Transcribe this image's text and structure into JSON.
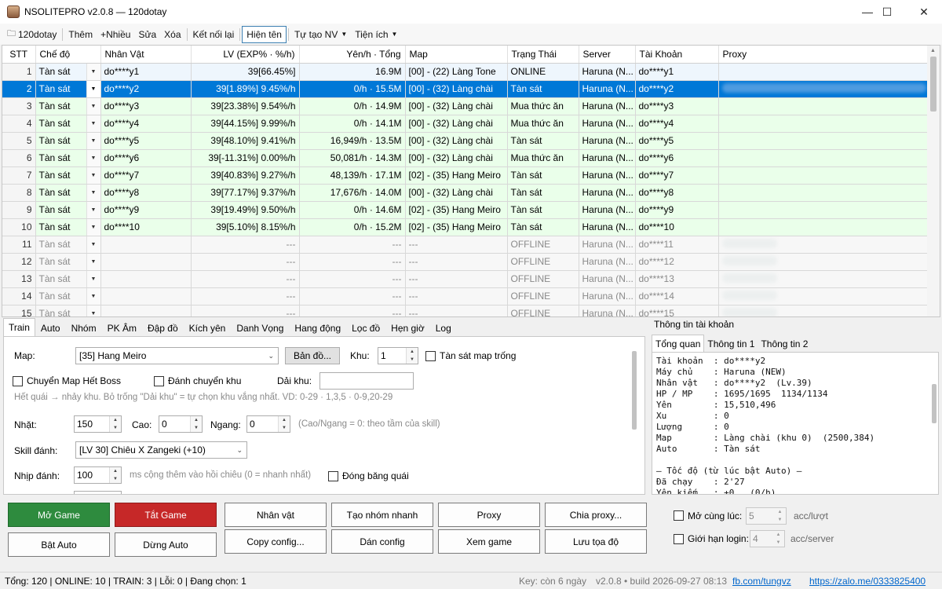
{
  "window": {
    "title": "NSOLITEPRO v2.0.8 — 120dotay",
    "minimize": "—",
    "maximize": "☐",
    "close": "✕"
  },
  "menu": [
    {
      "label": "120dotay",
      "icon": "folder-icon"
    },
    {
      "label": "Thêm"
    },
    {
      "label": "+Nhiều"
    },
    {
      "label": "Sửa"
    },
    {
      "label": "Xóa"
    },
    {
      "label": "Kết nối lại"
    },
    {
      "label": "Hiện tên",
      "selected": true
    },
    {
      "label": "Tự tạo NV",
      "dropdown": true
    },
    {
      "label": "Tiện ích",
      "dropdown": true
    }
  ],
  "grid": {
    "columns": [
      "STT",
      "Chế độ",
      "Nhân Vật",
      "LV (EXP% · %/h)",
      "Yên/h · Tổng",
      "Map",
      "Trạng Thái",
      "Server",
      "Tài Khoản",
      "Proxy"
    ],
    "rows": [
      {
        "stt": "1",
        "mode": "Tàn sát",
        "name": "do****y1",
        "lv": "39[66.45%]",
        "yen": "16.9M",
        "map": "[00] - (22) Làng Tone",
        "state": "ONLINE",
        "server": "Haruna (N...",
        "acct": "do****y1",
        "style": "first"
      },
      {
        "stt": "2",
        "mode": "Tàn sát",
        "name": "do****y2",
        "lv": "39[1.89%]  9.45%/h",
        "yen": "0/h  ·  15.5M",
        "map": "[00] - (32) Làng chài",
        "state": "Tàn sát",
        "server": "Haruna (N...",
        "acct": "do****y2",
        "style": "sel"
      },
      {
        "stt": "3",
        "mode": "Tàn sát",
        "name": "do****y3",
        "lv": "39[23.38%]  9.54%/h",
        "yen": "0/h  ·  14.9M",
        "map": "[00] - (32) Làng chài",
        "state": "Mua thức ăn",
        "server": "Haruna (N...",
        "acct": "do****y3",
        "style": "on"
      },
      {
        "stt": "4",
        "mode": "Tàn sát",
        "name": "do****y4",
        "lv": "39[44.15%]  9.99%/h",
        "yen": "0/h  ·  14.1M",
        "map": "[00] - (32) Làng chài",
        "state": "Mua thức ăn",
        "server": "Haruna (N...",
        "acct": "do****y4",
        "style": "on"
      },
      {
        "stt": "5",
        "mode": "Tàn sát",
        "name": "do****y5",
        "lv": "39[48.10%]  9.41%/h",
        "yen": "16,949/h  ·  13.5M",
        "map": "[00] - (32) Làng chài",
        "state": "Tàn sát",
        "server": "Haruna (N...",
        "acct": "do****y5",
        "style": "on"
      },
      {
        "stt": "6",
        "mode": "Tàn sát",
        "name": "do****y6",
        "lv": "39[-11.31%]  0.00%/h",
        "yen": "50,081/h  ·  14.3M",
        "map": "[00] - (32) Làng chài",
        "state": "Mua thức ăn",
        "server": "Haruna (N...",
        "acct": "do****y6",
        "style": "on"
      },
      {
        "stt": "7",
        "mode": "Tàn sát",
        "name": "do****y7",
        "lv": "39[40.83%]  9.27%/h",
        "yen": "48,139/h  ·  17.1M",
        "map": "[02] - (35) Hang Meiro",
        "state": "Tàn sát",
        "server": "Haruna (N...",
        "acct": "do****y7",
        "style": "on"
      },
      {
        "stt": "8",
        "mode": "Tàn sát",
        "name": "do****y8",
        "lv": "39[77.17%]  9.37%/h",
        "yen": "17,676/h  ·  14.0M",
        "map": "[00] - (32) Làng chài",
        "state": "Tàn sát",
        "server": "Haruna (N...",
        "acct": "do****y8",
        "style": "on"
      },
      {
        "stt": "9",
        "mode": "Tàn sát",
        "name": "do****y9",
        "lv": "39[19.49%]  9.50%/h",
        "yen": "0/h  ·  14.6M",
        "map": "[02] - (35) Hang Meiro",
        "state": "Tàn sát",
        "server": "Haruna (N...",
        "acct": "do****y9",
        "style": "on"
      },
      {
        "stt": "10",
        "mode": "Tàn sát",
        "name": "do****10",
        "lv": "39[5.10%]  8.15%/h",
        "yen": "0/h  ·  15.2M",
        "map": "[02] - (35) Hang Meiro",
        "state": "Tàn sát",
        "server": "Haruna (N...",
        "acct": "do****10",
        "style": "on"
      },
      {
        "stt": "11",
        "mode": "Tàn sát",
        "name": "",
        "lv": "---",
        "yen": "---",
        "map": "---",
        "state": "OFFLINE",
        "server": "Haruna (N...",
        "acct": "do****11",
        "style": "off"
      },
      {
        "stt": "12",
        "mode": "Tàn sát",
        "name": "",
        "lv": "---",
        "yen": "---",
        "map": "---",
        "state": "OFFLINE",
        "server": "Haruna (N...",
        "acct": "do****12",
        "style": "off"
      },
      {
        "stt": "13",
        "mode": "Tàn sát",
        "name": "",
        "lv": "---",
        "yen": "---",
        "map": "---",
        "state": "OFFLINE",
        "server": "Haruna (N...",
        "acct": "do****13",
        "style": "off"
      },
      {
        "stt": "14",
        "mode": "Tàn sát",
        "name": "",
        "lv": "---",
        "yen": "---",
        "map": "---",
        "state": "OFFLINE",
        "server": "Haruna (N...",
        "acct": "do****14",
        "style": "off"
      },
      {
        "stt": "15",
        "mode": "Tàn sát",
        "name": "",
        "lv": "---",
        "yen": "---",
        "map": "---",
        "state": "OFFLINE",
        "server": "Haruna (N...",
        "acct": "do****15",
        "style": "off"
      }
    ]
  },
  "tabs": [
    "Train",
    "Auto",
    "Nhóm",
    "PK Âm",
    "Đập đồ",
    "Kích yên",
    "Danh Vọng",
    "Hang động",
    "Lọc đồ",
    "Hẹn giờ",
    "Log"
  ],
  "train": {
    "map_label": "Map:",
    "map_value": "[35] Hang Meiro",
    "map_button": "Bản đồ...",
    "khu_label": "Khu:",
    "khu_value": "1",
    "tansat_empty": "Tàn sát map trống",
    "chuyen_map": "Chuyển Map Hết Boss",
    "danh_chuyen_khu": "Đánh chuyển khu",
    "dai_khu_label": "Dải khu:",
    "hint_khu": "Hết quái → nhảy khu. Bỏ trống \"Dải khu\" = tự chọn khu vắng nhất. VD: 0-29 · 1,3,5 · 0-9,20-29",
    "nhat_label": "Nhặt:",
    "nhat_value": "150",
    "cao_label": "Cao:",
    "cao_value": "0",
    "ngang_label": "Ngang:",
    "ngang_value": "0",
    "hint_cao": "(Cao/Ngang = 0: theo tầm của skill)",
    "skill_label": "Skill đánh:",
    "skill_value": "[LV 30] Chiêu X Zangeki (+10)",
    "nhip_label": "Nhịp đánh:",
    "nhip_value": "100",
    "hint_nhip": "ms cộng thêm vào hồi chiêu (0 = nhanh nhất)",
    "dong_bang": "Đóng băng quái"
  },
  "info": {
    "header": "Thông tin tài khoản",
    "tabs": [
      "Tổng quan",
      "Thông tin 1",
      "Thông tin 2"
    ],
    "text": "Tài khoản  : do****y2\nMáy chủ    : Haruna (NEW)\nNhân vật   : do****y2  (Lv.39)\nHP / MP    : 1695/1695  1134/1134\nYên        : 15,510,496\nXu         : 0\nLượng      : 0\nMap        : Làng chài (khu 0)  (2500,384)\nAuto       : Tàn sát\n\n— Tốc độ (từ lúc bật Auto) —\nĐã chạy    : 2'27\nYên kiếm   : +0   (0/h)"
  },
  "actions": {
    "mo_game": "Mở Game",
    "tat_game": "Tắt Game",
    "bat_auto": "Bật Auto",
    "dung_auto": "Dừng Auto",
    "nhan_vat": "Nhân vật",
    "tao_nhom": "Tạo nhóm nhanh",
    "proxy": "Proxy",
    "chia_proxy": "Chia proxy...",
    "copy_config": "Copy config...",
    "dan_config": "Dán config",
    "xem_game": "Xem game",
    "luu_toa_do": "Lưu tọa độ"
  },
  "options": {
    "mo_cung_luc": "Mở cùng lúc:",
    "mo_value": "5",
    "mo_unit": "acc/lượt",
    "gioi_han": "Giới hạn login:",
    "gioi_value": "4",
    "gioi_unit": "acc/server"
  },
  "status": {
    "left": "Tổng: 120   |   ONLINE: 10   |   TRAIN: 3   |   Lỗi: 0   |   Đang chọn: 1",
    "key": "Key: còn 6 ngày",
    "build": "v2.0.8 • build 2026-09-27 08:13",
    "fb": "fb.com/tungvz",
    "zalo": "https://zalo.me/0333825400"
  }
}
